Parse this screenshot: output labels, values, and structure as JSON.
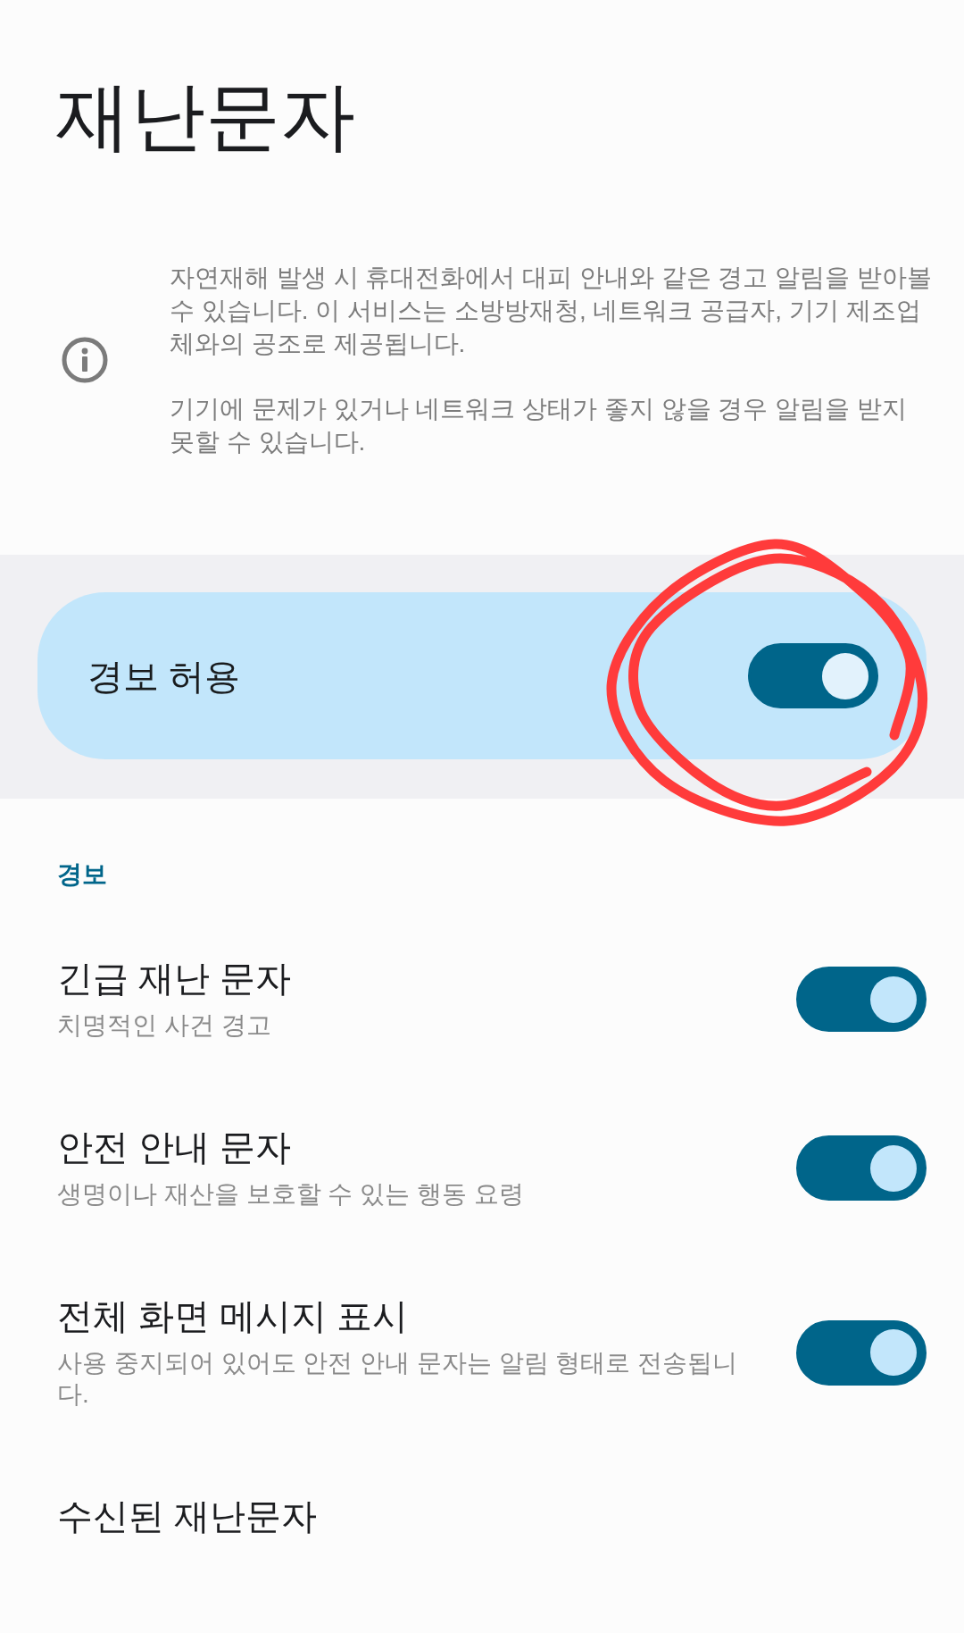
{
  "title": "재난문자",
  "info": {
    "paragraphs": [
      "자연재해 발생 시 휴대전화에서 대피 안내와 같은 경고 알림을 받아볼 수 있습니다. 이 서비스는 소방방재청, 네트워크 공급자, 기기 제조업체와의 공조로 제공됩니다.",
      "기기에 문제가 있거나 네트워크 상태가 좋지 않을 경우 알림을 받지 못할 수 있습니다."
    ]
  },
  "main_switch": {
    "label": "경보 허용",
    "on": true
  },
  "section": {
    "header": "경보",
    "items": [
      {
        "kind": "switch",
        "title": "긴급 재난 문자",
        "subtitle": "치명적인 사건 경고",
        "on": true
      },
      {
        "kind": "switch",
        "title": "안전 안내 문자",
        "subtitle": "생명이나 재산을 보호할 수 있는 행동 요령",
        "on": true
      },
      {
        "kind": "switch",
        "title": "전체 화면 메시지 표시",
        "subtitle": "사용 중지되어 있어도 안전 안내 문자는 알림 형태로 전송됩니다.",
        "on": true
      },
      {
        "kind": "link",
        "title": "수신된 재난문자"
      }
    ]
  }
}
